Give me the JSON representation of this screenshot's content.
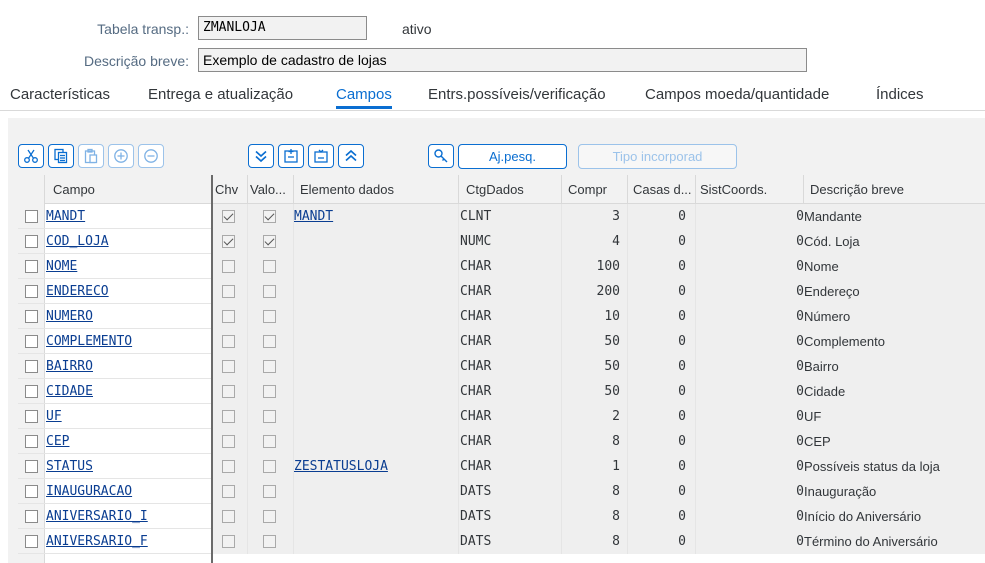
{
  "header": {
    "table_label": "Tabela transp.:",
    "table_value": "ZMANLOJA",
    "status": "ativo",
    "desc_label": "Descrição breve:",
    "desc_value": "Exemplo de cadastro de lojas"
  },
  "tabs": [
    {
      "label": "Características",
      "active": false
    },
    {
      "label": "Entrega e atualização",
      "active": false
    },
    {
      "label": "Campos",
      "active": true
    },
    {
      "label": "Entrs.possíveis/verificação",
      "active": false
    },
    {
      "label": "Campos moeda/quantidade",
      "active": false
    },
    {
      "label": "Índices",
      "active": false
    }
  ],
  "toolbar": {
    "icons": [
      "cut-icon",
      "copy-icon",
      "paste-icon",
      "insert-row-icon",
      "delete-row-icon",
      "expand-all-icon",
      "insert-structure-icon",
      "structure-icon",
      "collapse-all-icon",
      "search-help-icon"
    ],
    "ajpesq_label": "Aj.pesq.",
    "tipo_label": "Tipo incorporad"
  },
  "columns": [
    "Campo",
    "Chv",
    "Valo...",
    "Elemento dados",
    "CtgDados",
    "Compr",
    "Casas d...",
    "SistCoords.",
    "Descrição breve"
  ],
  "rows": [
    {
      "campo": "MANDT",
      "chv": true,
      "valo": true,
      "elemento": "MANDT",
      "ctg": "CLNT",
      "compr": "3",
      "casas": "0",
      "sist": "0",
      "desc": "Mandante"
    },
    {
      "campo": "COD_LOJA",
      "chv": true,
      "valo": true,
      "elemento": "",
      "ctg": "NUMC",
      "compr": "4",
      "casas": "0",
      "sist": "0",
      "desc": "Cód. Loja"
    },
    {
      "campo": "NOME",
      "chv": false,
      "valo": false,
      "elemento": "",
      "ctg": "CHAR",
      "compr": "100",
      "casas": "0",
      "sist": "0",
      "desc": "Nome"
    },
    {
      "campo": "ENDERECO",
      "chv": false,
      "valo": false,
      "elemento": "",
      "ctg": "CHAR",
      "compr": "200",
      "casas": "0",
      "sist": "0",
      "desc": "Endereço"
    },
    {
      "campo": "NUMERO",
      "chv": false,
      "valo": false,
      "elemento": "",
      "ctg": "CHAR",
      "compr": "10",
      "casas": "0",
      "sist": "0",
      "desc": "Número"
    },
    {
      "campo": "COMPLEMENTO",
      "chv": false,
      "valo": false,
      "elemento": "",
      "ctg": "CHAR",
      "compr": "50",
      "casas": "0",
      "sist": "0",
      "desc": "Complemento"
    },
    {
      "campo": "BAIRRO",
      "chv": false,
      "valo": false,
      "elemento": "",
      "ctg": "CHAR",
      "compr": "50",
      "casas": "0",
      "sist": "0",
      "desc": "Bairro"
    },
    {
      "campo": "CIDADE",
      "chv": false,
      "valo": false,
      "elemento": "",
      "ctg": "CHAR",
      "compr": "50",
      "casas": "0",
      "sist": "0",
      "desc": "Cidade"
    },
    {
      "campo": "UF",
      "chv": false,
      "valo": false,
      "elemento": "",
      "ctg": "CHAR",
      "compr": "2",
      "casas": "0",
      "sist": "0",
      "desc": "UF"
    },
    {
      "campo": "CEP",
      "chv": false,
      "valo": false,
      "elemento": "",
      "ctg": "CHAR",
      "compr": "8",
      "casas": "0",
      "sist": "0",
      "desc": "CEP"
    },
    {
      "campo": "STATUS",
      "chv": false,
      "valo": false,
      "elemento": "ZESTATUSLOJA",
      "ctg": "CHAR",
      "compr": "1",
      "casas": "0",
      "sist": "0",
      "desc": "Possíveis status da loja"
    },
    {
      "campo": "INAUGURACAO",
      "chv": false,
      "valo": false,
      "elemento": "",
      "ctg": "DATS",
      "compr": "8",
      "casas": "0",
      "sist": "0",
      "desc": "Inauguração"
    },
    {
      "campo": "ANIVERSARIO_I",
      "chv": false,
      "valo": false,
      "elemento": "",
      "ctg": "DATS",
      "compr": "8",
      "casas": "0",
      "sist": "0",
      "desc": "Início do Aniversário"
    },
    {
      "campo": "ANIVERSARIO_F",
      "chv": false,
      "valo": false,
      "elemento": "",
      "ctg": "DATS",
      "compr": "8",
      "casas": "0",
      "sist": "0",
      "desc": "Término do Aniversário"
    }
  ]
}
